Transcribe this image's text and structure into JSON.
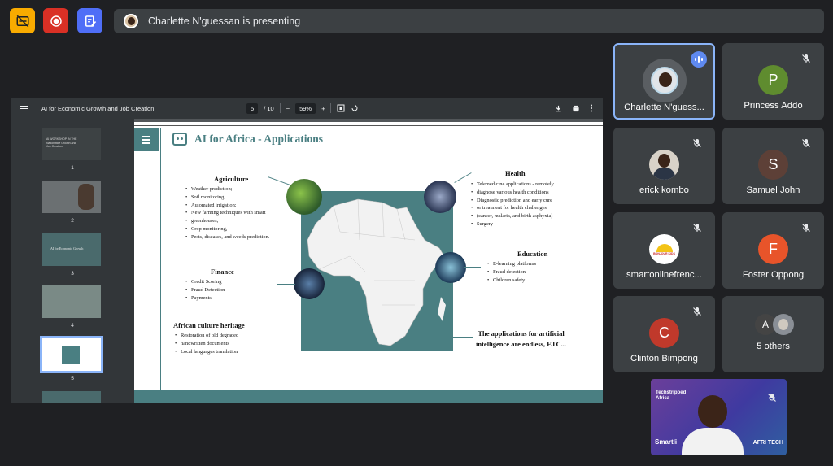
{
  "colors": {
    "background": "#1f2023",
    "tile": "#3c4043",
    "accent_blue": "#8ab4f8",
    "slide_teal": "#4a7f82",
    "btn_yellow": "#f9ab00",
    "btn_red": "#d93025",
    "btn_blue": "#4f6ef7"
  },
  "toolbar": {
    "captions_icon": "captions-off-icon",
    "record_icon": "record-icon",
    "notes_icon": "edit-note-icon"
  },
  "presenting_banner": {
    "text": "Charlette N'guessan is presenting"
  },
  "pdf_viewer": {
    "title": "AI for Economic Growth and Job Creation",
    "page_current": "5",
    "page_total": "/ 10",
    "zoom_minus": "−",
    "zoom": "59%",
    "zoom_plus": "+",
    "thumbnails": [
      {
        "num": "1"
      },
      {
        "num": "2"
      },
      {
        "num": "3",
        "title": "AI for Economic Growth"
      },
      {
        "num": "4"
      },
      {
        "num": "5"
      }
    ],
    "thumb1_text": "AI WORKSHOP IN THE Nationwide Growth and Job Creation"
  },
  "slide": {
    "title": "AI for Africa - Applications",
    "agriculture": {
      "heading": "Agriculture",
      "items": [
        "Weather prediction;",
        "Soil monitoring",
        "Automated irrigation;",
        "New farming techniques with smart",
        "greenhouses;",
        "Crop monitoring,",
        "Pests, diseases, and weeds prediction."
      ]
    },
    "health": {
      "heading": "Health",
      "items": [
        "Telemedicine applications - remotely",
        "diagnose various health conditions",
        "Diagnostic prediction and early cure",
        "or treatment for health challenges",
        "(cancer, malaria, and birth asphyxia)",
        "Surgery"
      ]
    },
    "finance": {
      "heading": "Finance",
      "items": [
        "Credit Scoring",
        "Fraud Detection",
        "Payments"
      ]
    },
    "education": {
      "heading": "Education",
      "items": [
        "E-learning platforms",
        "Fraud detection",
        "Children safety"
      ]
    },
    "culture": {
      "heading": "African culture heritage",
      "items": [
        "Restoration of old degraded",
        "handwritten documents",
        "Local languages translation"
      ]
    },
    "conclusion_line1": "The applications for artificial",
    "conclusion_line2": "intelligence are endless, ETC..."
  },
  "participants": [
    {
      "name": "Charlette N'guess...",
      "type": "photo",
      "speaking": true
    },
    {
      "name": "Princess Addo",
      "initial": "P",
      "color": "#5f8c2f",
      "muted": true
    },
    {
      "name": "erick kombo",
      "type": "photo",
      "muted": true
    },
    {
      "name": "Samuel John",
      "initial": "S",
      "color": "#5d4037",
      "muted": true
    },
    {
      "name": "smartonlinefrenc...",
      "type": "logo",
      "logo_text": "BONJOUR KIDS",
      "muted": true
    },
    {
      "name": "Foster Oppong",
      "initial": "F",
      "color": "#e8542a",
      "muted": true
    },
    {
      "name": "Clinton Bimpong",
      "initial": "C",
      "color": "#c0392b",
      "muted": true
    },
    {
      "name": "5 others",
      "initial": "A",
      "color": "#444"
    }
  ],
  "self_view": {
    "brand_line1": "Techstripped",
    "brand_line2": "Africa",
    "left_label": "Smartli",
    "right_label": "AFRI TECH"
  }
}
